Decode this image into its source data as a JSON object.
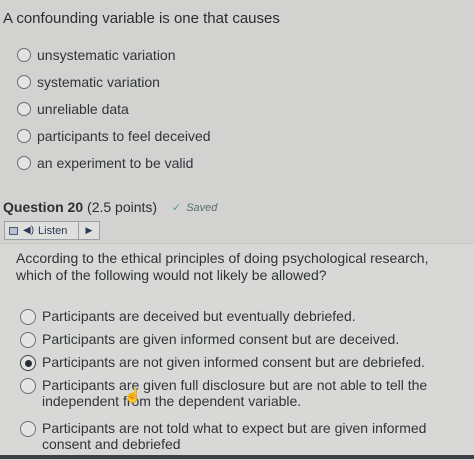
{
  "question19": {
    "prompt": "A confounding variable is one that causes",
    "options": [
      "unsystematic variation",
      "systematic variation",
      "unreliable data",
      "participants to feel deceived",
      "an experiment to be valid"
    ]
  },
  "question20": {
    "title": "Question 20",
    "points": "(2.5 points)",
    "saved": "Saved",
    "listen_label": "Listen",
    "prompt": "According to the ethical principles of doing psychological research, which of the following would not likely be allowed?",
    "options": [
      "Participants are deceived but eventually debriefed.",
      "Participants are given informed consent but are deceived.",
      "Participants are not given informed consent but are debriefed.",
      "Participants are given full disclosure but are not able to tell the independent from the dependent variable.",
      "Participants are not told what to expect but are given informed consent and debriefed"
    ],
    "selected_index": 2
  },
  "icons": {
    "speaker": "speaker-icon",
    "play": "play-icon",
    "check": "check-icon",
    "grid": "toolbar-grid-icon",
    "cursor": "hand-cursor-icon"
  },
  "colors": {
    "background": "#d2d3d1",
    "saved_check": "#5a9a84"
  }
}
